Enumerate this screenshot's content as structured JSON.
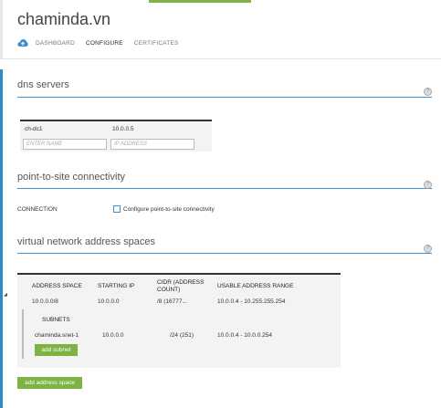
{
  "header": {
    "title": "chaminda.vn",
    "nav": [
      "DASHBOARD",
      "CONFIGURE",
      "CERTIFICATES"
    ],
    "active_nav": "CONFIGURE"
  },
  "dns": {
    "section_title": "dns servers",
    "rows": [
      {
        "name": "ch-dc1",
        "ip": "10.0.0.5"
      }
    ],
    "name_placeholder": "ENTER NAME",
    "ip_placeholder": "IP ADDRESS"
  },
  "p2s": {
    "section_title": "point-to-site connectivity",
    "connection_label": "CONNECTION",
    "checkbox_label": "Configure point-to-site connectivity"
  },
  "vnet": {
    "section_title": "virtual network address spaces",
    "headers": {
      "address_space": "ADDRESS SPACE",
      "starting_ip": "STARTING IP",
      "cidr": "CIDR (ADDRESS COUNT)",
      "usable": "USABLE ADDRESS RANGE"
    },
    "address_space": {
      "address": "10.0.0.0/8",
      "starting_ip": "10.0.0.0",
      "cidr": "/8 (16777...",
      "usable": "10.0.0.4 - 10.255.255.254"
    },
    "subnets_label": "SUBNETS",
    "subnet": {
      "name": "chaminda.snet-1",
      "starting_ip": "10.0.0.0",
      "cidr": "/24 (251)",
      "usable": "10.0.0.4 - 10.0.0.254"
    },
    "add_subnet_label": "add subnet",
    "add_address_space_label": "add address space"
  },
  "colors": {
    "accent_blue": "#2d8ac9",
    "green": "#7cb342"
  },
  "icons": {
    "nav_cloud": "cloud-upload-icon",
    "help": "help-icon",
    "expand": "collapse-triangle-icon"
  }
}
